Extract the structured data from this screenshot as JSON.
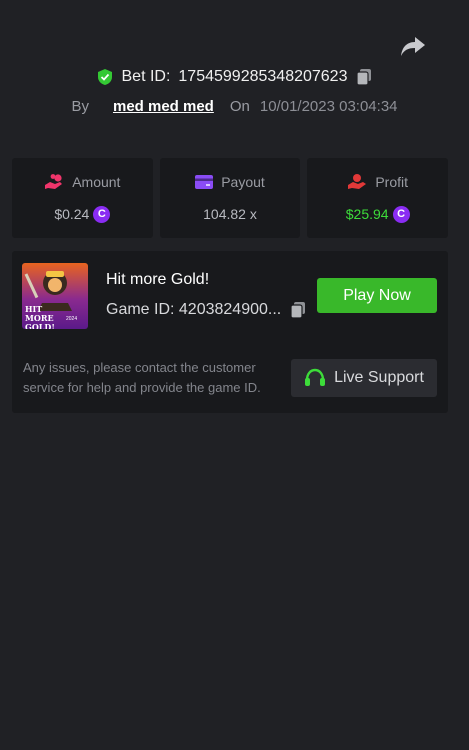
{
  "header": {
    "bet_id_label": "Bet ID:",
    "bet_id": "1754599285348207623",
    "by_label": "By",
    "username": "med med med",
    "on_label": "On",
    "datetime": "10/01/2023 03:04:34"
  },
  "stats": {
    "amount": {
      "label": "Amount",
      "value": "$0.24",
      "icon": "hand-coin-icon"
    },
    "payout": {
      "label": "Payout",
      "value": "104.82 x",
      "icon": "card-icon"
    },
    "profit": {
      "label": "Profit",
      "value": "$25.94",
      "icon": "hand-profit-icon"
    },
    "coin_symbol": "C"
  },
  "game": {
    "name": "Hit more Gold!",
    "id_label": "Game ID: 4203824900...",
    "play_label": "Play Now",
    "thumb_text": "HIT MORE GOLD!",
    "thumb_small": "2024"
  },
  "support": {
    "help_text": "Any issues, please contact the customer service for help and provide the game ID.",
    "button_label": "Live Support"
  },
  "colors": {
    "background": "#202125",
    "card": "#18191c",
    "accent_green": "#39b82a",
    "profit_green": "#3ddc3a",
    "coin_purple": "#8a2cf3"
  }
}
